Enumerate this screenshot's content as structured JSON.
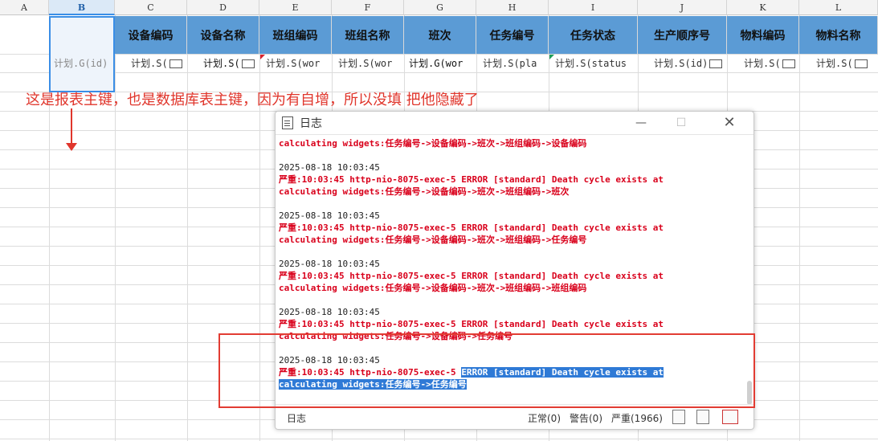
{
  "columns": [
    "A",
    "B",
    "C",
    "D",
    "E",
    "F",
    "G",
    "H",
    "I",
    "J",
    "K",
    "L"
  ],
  "selected_column": "B",
  "headers": [
    "设备编码",
    "设备名称",
    "班组编码",
    "班组名称",
    "班次",
    "任务编号",
    "任务状态",
    "生产顺序号",
    "物料编码",
    "物料名称"
  ],
  "row2": [
    "计划.G(id)",
    "计划.S(",
    "计划.S(",
    "计划.S(wor",
    "计划.S(wor",
    "计划.G(wor",
    "计划.S(pla",
    "计划.S(status",
    "计划.S(id)",
    "计划.S(",
    "计划.S("
  ],
  "annotation": "这是报表主键，也是数据库表主键，因为有自增，所以没填 把他隐藏了",
  "dialog": {
    "title": "日志",
    "entries": [
      {
        "time": "",
        "line1": "",
        "line2": "calculating widgets:任务编号->设备编码->班次->班组编码->设备编码"
      },
      {
        "time": "2025-08-18 10:03:45",
        "line1": "严重:10:03:45 http-nio-8075-exec-5 ERROR [standard] Death cycle exists at",
        "line2": "calculating widgets:任务编号->设备编码->班次->班组编码->班次"
      },
      {
        "time": "2025-08-18 10:03:45",
        "line1": "严重:10:03:45 http-nio-8075-exec-5 ERROR [standard] Death cycle exists at",
        "line2": "calculating widgets:任务编号->设备编码->班次->班组编码->任务编号"
      },
      {
        "time": "2025-08-18 10:03:45",
        "line1": "严重:10:03:45 http-nio-8075-exec-5 ERROR [standard] Death cycle exists at",
        "line2": "calculating widgets:任务编号->设备编码->班次->班组编码->班组编码"
      },
      {
        "time": "2025-08-18 10:03:45",
        "line1": "严重:10:03:45 http-nio-8075-exec-5 ERROR [standard] Death cycle exists at",
        "line2": "calculating widgets:任务编号->设备编码->任务编号"
      }
    ],
    "last": {
      "time": "2025-08-18 10:03:45",
      "line1_pre": "严重:10:03:45 http-nio-8075-exec-5 ",
      "line1_hl": "ERROR [standard] Death cycle exists at",
      "line2": "calculating widgets:任务编号->任务编号"
    },
    "status": {
      "label": "日志",
      "normal": "正常(0)",
      "warn": "警告(0)",
      "severe": "严重(1966)"
    }
  },
  "colors": {
    "header_blue": "#5b9bd5",
    "error_red": "#d9001b",
    "annotation_red": "#e0362c",
    "highlight": "#2f7ad6"
  }
}
